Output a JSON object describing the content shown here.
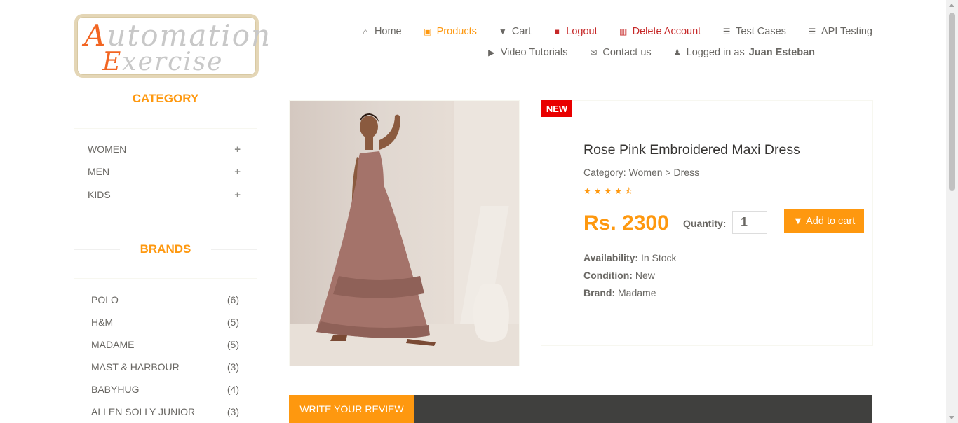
{
  "logo": {
    "line1_cap": "A",
    "line1_rest": "utomation",
    "line2_cap": "E",
    "line2_rest": "xercise"
  },
  "nav": {
    "row1": [
      {
        "label": "Home",
        "icon": "home-icon",
        "glyph": "⌂"
      },
      {
        "label": "Products",
        "icon": "products-icon",
        "glyph": "▣"
      },
      {
        "label": "Cart",
        "icon": "cart-icon",
        "glyph": "▼"
      },
      {
        "label": "Logout",
        "icon": "lock-icon",
        "glyph": "■"
      },
      {
        "label": "Delete Account",
        "icon": "trash-icon",
        "glyph": "▥"
      },
      {
        "label": "Test Cases",
        "icon": "list-icon",
        "glyph": "☰"
      },
      {
        "label": "API Testing",
        "icon": "list-icon",
        "glyph": "☰"
      }
    ],
    "row2": [
      {
        "label": "Video Tutorials",
        "icon": "youtube-icon",
        "glyph": "▶"
      },
      {
        "label": "Contact us",
        "icon": "envelope-icon",
        "glyph": "✉"
      }
    ],
    "logged_in_prefix": "Logged in as",
    "logged_in_user": "Juan Esteban",
    "user_glyph": "♟"
  },
  "sidebar": {
    "category_title": "CATEGORY",
    "categories": [
      "WOMEN",
      "MEN",
      "KIDS"
    ],
    "plus": "+",
    "brands_title": "BRANDS",
    "brands": [
      {
        "name": "POLO",
        "count": "(6)"
      },
      {
        "name": "H&M",
        "count": "(5)"
      },
      {
        "name": "MADAME",
        "count": "(5)"
      },
      {
        "name": "MAST & HARBOUR",
        "count": "(3)"
      },
      {
        "name": "BABYHUG",
        "count": "(4)"
      },
      {
        "name": "ALLEN SOLLY JUNIOR",
        "count": "(3)"
      }
    ]
  },
  "product": {
    "badge": "NEW",
    "name": "Rose Pink Embroidered Maxi Dress",
    "category": "Category: Women > Dress",
    "rating": 4.5,
    "stars": "★★★★⯪",
    "price": "Rs. 2300",
    "quantity_label": "Quantity:",
    "quantity": "1",
    "add_to_cart": "Add to cart",
    "cart_glyph": "▼",
    "availability_label": "Availability:",
    "availability": "In Stock",
    "condition_label": "Condition:",
    "condition": "New",
    "brand_label": "Brand:",
    "brand": "Madame"
  },
  "review": {
    "tab_label": "WRITE YOUR REVIEW"
  },
  "colors": {
    "accent": "#fe980f",
    "danger": "#c62828",
    "badge": "#e90000",
    "text": "#696763"
  }
}
